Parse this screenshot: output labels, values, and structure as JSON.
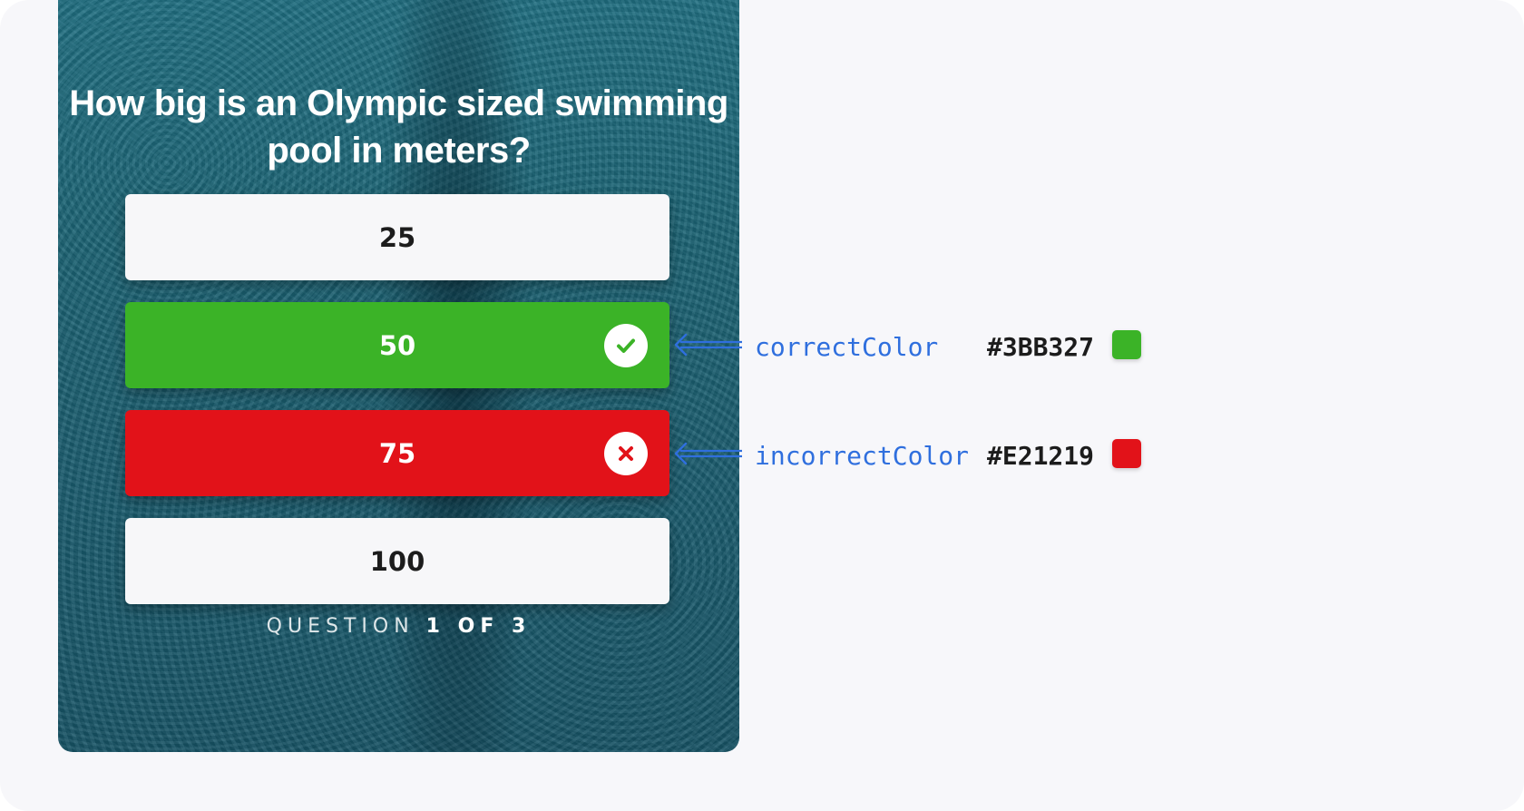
{
  "quiz": {
    "question": "How big is an Olympic sized swimming pool in meters?",
    "answers": [
      {
        "label": "25",
        "state": "neutral"
      },
      {
        "label": "50",
        "state": "correct",
        "icon": "check-icon"
      },
      {
        "label": "75",
        "state": "incorrect",
        "icon": "x-icon"
      },
      {
        "label": "100",
        "state": "neutral"
      }
    ],
    "progress": {
      "prefix": "QUESTION",
      "current": "1 OF 3"
    }
  },
  "annotations": [
    {
      "name": "correctColor",
      "hex": "#3BB327",
      "color": "#3BB327"
    },
    {
      "name": "incorrectColor",
      "hex": "#E21219",
      "color": "#E21219"
    }
  ],
  "colors": {
    "correct": "#3BB327",
    "incorrect": "#E21219",
    "annotation_text": "#2f6fde",
    "canvas": "#f7f7fa"
  }
}
